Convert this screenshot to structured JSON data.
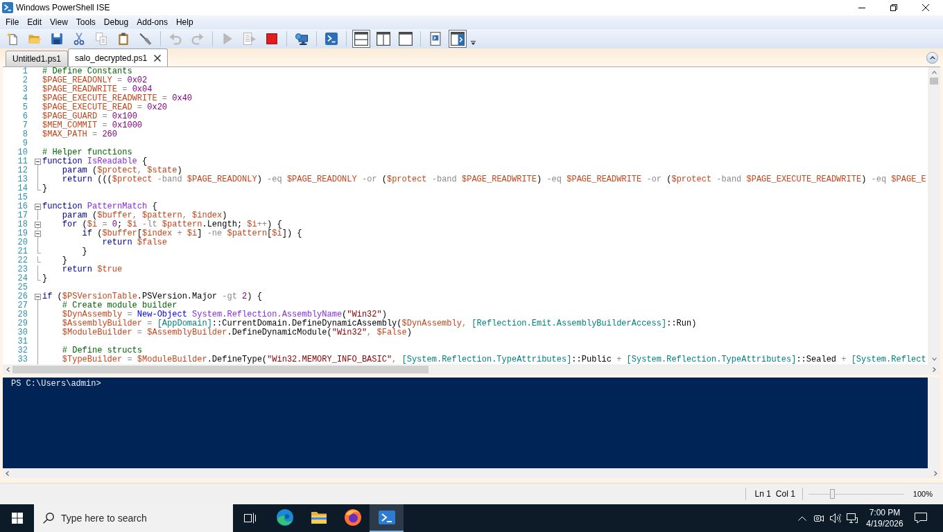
{
  "window": {
    "title": "Windows PowerShell ISE"
  },
  "menu": [
    "File",
    "Edit",
    "View",
    "Tools",
    "Debug",
    "Add-ons",
    "Help"
  ],
  "toolbar": [
    {
      "kind": "new",
      "disabled": false
    },
    {
      "kind": "open",
      "disabled": false
    },
    {
      "kind": "save",
      "disabled": false
    },
    {
      "kind": "cut",
      "disabled": false
    },
    {
      "kind": "copy",
      "disabled": true
    },
    {
      "kind": "paste",
      "disabled": false
    },
    {
      "kind": "clear",
      "disabled": false
    },
    {
      "kind": "separator"
    },
    {
      "kind": "undo",
      "disabled": true
    },
    {
      "kind": "redo",
      "disabled": true
    },
    {
      "kind": "separator"
    },
    {
      "kind": "run",
      "disabled": true
    },
    {
      "kind": "run-selection",
      "disabled": true
    },
    {
      "kind": "stop",
      "disabled": false
    },
    {
      "kind": "separator"
    },
    {
      "kind": "remote-tab",
      "disabled": false
    },
    {
      "kind": "separator"
    },
    {
      "kind": "console",
      "disabled": false
    },
    {
      "kind": "separator"
    },
    {
      "kind": "pane-top",
      "pressed": true
    },
    {
      "kind": "pane-right",
      "pressed": false
    },
    {
      "kind": "pane-maximized",
      "pressed": false
    },
    {
      "kind": "separator"
    },
    {
      "kind": "command-window",
      "pressed": false
    },
    {
      "kind": "command-addon",
      "pressed": true
    },
    {
      "kind": "more"
    }
  ],
  "tabs": [
    {
      "label": "Untitled1.ps1",
      "selected": false
    },
    {
      "label": "salo_decrypted.ps1",
      "selected": true
    }
  ],
  "editor": {
    "lines": [
      {
        "number": "1",
        "kind": "plain",
        "tokens": [
          {
            "kind": "comment",
            "text": "# Define Constants"
          }
        ]
      },
      {
        "number": "2",
        "kind": "plain",
        "tokens": [
          {
            "kind": "variable",
            "text": "$PAGE_READONLY"
          },
          {
            "kind": "operator",
            "text": " = "
          },
          {
            "kind": "number",
            "text": "0x02"
          }
        ]
      },
      {
        "number": "3",
        "kind": "plain",
        "tokens": [
          {
            "kind": "variable",
            "text": "$PAGE_READWRITE"
          },
          {
            "kind": "operator",
            "text": " = "
          },
          {
            "kind": "number",
            "text": "0x04"
          }
        ]
      },
      {
        "number": "4",
        "kind": "plain",
        "tokens": [
          {
            "kind": "variable",
            "text": "$PAGE_EXECUTE_READWRITE"
          },
          {
            "kind": "operator",
            "text": " = "
          },
          {
            "kind": "number",
            "text": "0x40"
          }
        ]
      },
      {
        "number": "5",
        "kind": "plain",
        "tokens": [
          {
            "kind": "variable",
            "text": "$PAGE_EXECUTE_READ"
          },
          {
            "kind": "operator",
            "text": " = "
          },
          {
            "kind": "number",
            "text": "0x20"
          }
        ]
      },
      {
        "number": "6",
        "kind": "plain",
        "tokens": [
          {
            "kind": "variable",
            "text": "$PAGE_GUARD"
          },
          {
            "kind": "operator",
            "text": " = "
          },
          {
            "kind": "number",
            "text": "0x100"
          }
        ]
      },
      {
        "number": "7",
        "kind": "plain",
        "tokens": [
          {
            "kind": "variable",
            "text": "$MEM_COMMIT"
          },
          {
            "kind": "operator",
            "text": " = "
          },
          {
            "kind": "number",
            "text": "0x1000"
          }
        ]
      },
      {
        "number": "8",
        "kind": "plain",
        "tokens": [
          {
            "kind": "variable",
            "text": "$MAX_PATH"
          },
          {
            "kind": "operator",
            "text": " = "
          },
          {
            "kind": "number",
            "text": "260"
          }
        ]
      },
      {
        "number": "9",
        "kind": "plain"
      },
      {
        "number": "10",
        "kind": "plain",
        "tokens": [
          {
            "kind": "comment",
            "text": "# Helper functions"
          }
        ]
      },
      {
        "number": "11",
        "kind": "fold-start",
        "expanded": true,
        "tokens": [
          {
            "kind": "keyword",
            "text": "function "
          },
          {
            "kind": "argument",
            "text": "IsReadable "
          },
          {
            "kind": "plain",
            "text": "{"
          }
        ]
      },
      {
        "number": "12",
        "kind": "fold-guide",
        "tokens": [
          {
            "kind": "keyword",
            "text": "    param "
          },
          {
            "kind": "plain",
            "text": "("
          },
          {
            "kind": "variable",
            "text": "$protect"
          },
          {
            "kind": "operator",
            "text": ", "
          },
          {
            "kind": "variable",
            "text": "$state"
          },
          {
            "kind": "plain",
            "text": ")"
          }
        ]
      },
      {
        "number": "13",
        "kind": "fold-guide",
        "tokens": [
          {
            "kind": "keyword",
            "text": "    return "
          },
          {
            "kind": "plain",
            "text": "((("
          },
          {
            "kind": "variable",
            "text": "$protect "
          },
          {
            "kind": "operator",
            "text": "-band "
          },
          {
            "kind": "variable",
            "text": "$PAGE_READONLY"
          },
          {
            "kind": "plain",
            "text": ") "
          },
          {
            "kind": "operator",
            "text": "-eq "
          },
          {
            "kind": "variable",
            "text": "$PAGE_READONLY "
          },
          {
            "kind": "operator",
            "text": "-or "
          },
          {
            "kind": "plain",
            "text": "("
          },
          {
            "kind": "variable",
            "text": "$protect "
          },
          {
            "kind": "operator",
            "text": "-band "
          },
          {
            "kind": "variable",
            "text": "$PAGE_READWRITE"
          },
          {
            "kind": "plain",
            "text": ") "
          },
          {
            "kind": "operator",
            "text": "-eq "
          },
          {
            "kind": "variable",
            "text": "$PAGE_READWRITE "
          },
          {
            "kind": "operator",
            "text": "-or "
          },
          {
            "kind": "plain",
            "text": "("
          },
          {
            "kind": "variable",
            "text": "$protect "
          },
          {
            "kind": "operator",
            "text": "-band "
          },
          {
            "kind": "variable",
            "text": "$PAGE_EXECUTE_READWRITE"
          },
          {
            "kind": "plain",
            "text": ") "
          },
          {
            "kind": "operator",
            "text": "-eq "
          },
          {
            "kind": "variable",
            "text": "$PAGE_E"
          }
        ]
      },
      {
        "number": "14",
        "kind": "fold-end",
        "tokens": [
          {
            "kind": "plain",
            "text": "}"
          }
        ]
      },
      {
        "number": "15",
        "kind": "plain"
      },
      {
        "number": "16",
        "kind": "fold-start",
        "expanded": true,
        "tokens": [
          {
            "kind": "keyword",
            "text": "function "
          },
          {
            "kind": "argument",
            "text": "PatternMatch "
          },
          {
            "kind": "plain",
            "text": "{"
          }
        ]
      },
      {
        "number": "17",
        "kind": "fold-guide",
        "tokens": [
          {
            "kind": "keyword",
            "text": "    param "
          },
          {
            "kind": "plain",
            "text": "("
          },
          {
            "kind": "variable",
            "text": "$buffer"
          },
          {
            "kind": "operator",
            "text": ", "
          },
          {
            "kind": "variable",
            "text": "$pattern"
          },
          {
            "kind": "operator",
            "text": ", "
          },
          {
            "kind": "variable",
            "text": "$index"
          },
          {
            "kind": "plain",
            "text": ")"
          }
        ]
      },
      {
        "number": "18",
        "kind": "fold-start",
        "expanded": true,
        "tokens": [
          {
            "kind": "keyword",
            "text": "    for "
          },
          {
            "kind": "plain",
            "text": "("
          },
          {
            "kind": "variable",
            "text": "$i"
          },
          {
            "kind": "operator",
            "text": " = "
          },
          {
            "kind": "number",
            "text": "0"
          },
          {
            "kind": "plain",
            "text": "; "
          },
          {
            "kind": "variable",
            "text": "$i "
          },
          {
            "kind": "operator",
            "text": "-lt "
          },
          {
            "kind": "variable",
            "text": "$pattern"
          },
          {
            "kind": "plain",
            "text": ".Length; "
          },
          {
            "kind": "variable",
            "text": "$i"
          },
          {
            "kind": "operator",
            "text": "++"
          },
          {
            "kind": "plain",
            "text": ") {"
          }
        ]
      },
      {
        "number": "19",
        "kind": "fold-start",
        "expanded": true,
        "tokens": [
          {
            "kind": "keyword",
            "text": "        if "
          },
          {
            "kind": "plain",
            "text": "("
          },
          {
            "kind": "variable",
            "text": "$buffer"
          },
          {
            "kind": "plain",
            "text": "["
          },
          {
            "kind": "variable",
            "text": "$index "
          },
          {
            "kind": "operator",
            "text": "+ "
          },
          {
            "kind": "variable",
            "text": "$i"
          },
          {
            "kind": "plain",
            "text": "] "
          },
          {
            "kind": "operator",
            "text": "-ne "
          },
          {
            "kind": "variable",
            "text": "$pattern"
          },
          {
            "kind": "plain",
            "text": "["
          },
          {
            "kind": "variable",
            "text": "$i"
          },
          {
            "kind": "plain",
            "text": "]) {"
          }
        ]
      },
      {
        "number": "20",
        "kind": "fold-guide",
        "tokens": [
          {
            "kind": "keyword",
            "text": "            return "
          },
          {
            "kind": "variable",
            "text": "$false"
          }
        ]
      },
      {
        "number": "21",
        "kind": "fold-end",
        "tokens": [
          {
            "kind": "plain",
            "text": "        }"
          }
        ]
      },
      {
        "number": "22",
        "kind": "fold-end",
        "tokens": [
          {
            "kind": "plain",
            "text": "    }"
          }
        ]
      },
      {
        "number": "23",
        "kind": "fold-guide",
        "tokens": [
          {
            "kind": "keyword",
            "text": "    return "
          },
          {
            "kind": "variable",
            "text": "$true"
          }
        ]
      },
      {
        "number": "24",
        "kind": "fold-end",
        "tokens": [
          {
            "kind": "plain",
            "text": "}"
          }
        ]
      },
      {
        "number": "25",
        "kind": "plain"
      },
      {
        "number": "26",
        "kind": "fold-start",
        "expanded": true,
        "tokens": [
          {
            "kind": "keyword",
            "text": "if "
          },
          {
            "kind": "plain",
            "text": "("
          },
          {
            "kind": "variable",
            "text": "$PSVersionTable"
          },
          {
            "kind": "plain",
            "text": ".PSVersion.Major "
          },
          {
            "kind": "operator",
            "text": "-gt "
          },
          {
            "kind": "number",
            "text": "2"
          },
          {
            "kind": "plain",
            "text": ") {"
          }
        ]
      },
      {
        "number": "27",
        "kind": "fold-guide",
        "tokens": [
          {
            "kind": "comment",
            "text": "    # Create module builder"
          }
        ]
      },
      {
        "number": "28",
        "kind": "fold-guide",
        "tokens": [
          {
            "kind": "variable",
            "text": "    $DynAssembly"
          },
          {
            "kind": "operator",
            "text": " = "
          },
          {
            "kind": "command",
            "text": "New-Object "
          },
          {
            "kind": "argument",
            "text": "System.Reflection.AssemblyName"
          },
          {
            "kind": "plain",
            "text": "("
          },
          {
            "kind": "string",
            "text": "\"Win32\""
          },
          {
            "kind": "plain",
            "text": ")"
          }
        ]
      },
      {
        "number": "29",
        "kind": "fold-guide",
        "tokens": [
          {
            "kind": "variable",
            "text": "    $AssemblyBuilder"
          },
          {
            "kind": "operator",
            "text": " = "
          },
          {
            "kind": "type",
            "text": "[AppDomain]"
          },
          {
            "kind": "plain",
            "text": "::CurrentDomain.DefineDynamicAssembly("
          },
          {
            "kind": "variable",
            "text": "$DynAssembly"
          },
          {
            "kind": "operator",
            "text": ", "
          },
          {
            "kind": "type",
            "text": "[Reflection.Emit.AssemblyBuilderAccess]"
          },
          {
            "kind": "plain",
            "text": "::Run)"
          }
        ]
      },
      {
        "number": "30",
        "kind": "fold-guide",
        "tokens": [
          {
            "kind": "variable",
            "text": "    $ModuleBuilder"
          },
          {
            "kind": "operator",
            "text": " = "
          },
          {
            "kind": "variable",
            "text": "$AssemblyBuilder"
          },
          {
            "kind": "plain",
            "text": ".DefineDynamicModule("
          },
          {
            "kind": "string",
            "text": "\"Win32\""
          },
          {
            "kind": "operator",
            "text": ", "
          },
          {
            "kind": "variable",
            "text": "$False"
          },
          {
            "kind": "plain",
            "text": ")"
          }
        ]
      },
      {
        "number": "31",
        "kind": "fold-guide"
      },
      {
        "number": "32",
        "kind": "fold-guide",
        "tokens": [
          {
            "kind": "comment",
            "text": "    # Define structs"
          }
        ]
      },
      {
        "number": "33",
        "kind": "fold-guide",
        "tokens": [
          {
            "kind": "variable",
            "text": "    $TypeBuilder"
          },
          {
            "kind": "operator",
            "text": " = "
          },
          {
            "kind": "variable",
            "text": "$ModuleBuilder"
          },
          {
            "kind": "plain",
            "text": ".DefineType("
          },
          {
            "kind": "string",
            "text": "\"Win32.MEMORY_INFO_BASIC\""
          },
          {
            "kind": "operator",
            "text": ", "
          },
          {
            "kind": "type",
            "text": "[System.Reflection.TypeAttributes]"
          },
          {
            "kind": "plain",
            "text": "::Public "
          },
          {
            "kind": "operator",
            "text": "+ "
          },
          {
            "kind": "type",
            "text": "[System.Reflection.TypeAttributes]"
          },
          {
            "kind": "plain",
            "text": "::Sealed "
          },
          {
            "kind": "operator",
            "text": "+ "
          },
          {
            "kind": "type",
            "text": "[System.Reflect"
          }
        ]
      }
    ]
  },
  "console": {
    "lines": [
      "PS C:\\Users\\admin>"
    ]
  },
  "status_bar": {
    "line": "Ln 1",
    "column": "Col 1",
    "zoom": {
      "level": 0.25,
      "reading": "100%"
    }
  },
  "taskbar": {
    "search": {
      "placeholder": "Type here to search"
    },
    "apps": [
      {
        "kind": "edge",
        "selected": false
      },
      {
        "kind": "explorer",
        "selected": false
      },
      {
        "kind": "firefox",
        "selected": false
      },
      {
        "kind": "ise",
        "selected": true
      }
    ],
    "clock": {
      "time": "7:00 PM",
      "date": "4/19/2026"
    }
  }
}
